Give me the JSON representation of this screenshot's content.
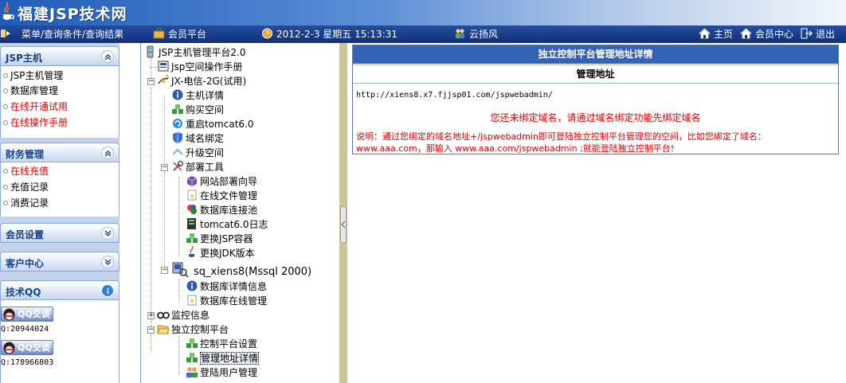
{
  "header": {
    "title": "福建JSP技术网"
  },
  "toolbar": {
    "menu": "菜单/查询条件/查询结果",
    "member_platform": "会员平台",
    "datetime": "2012-2-3 星期五 15:13:31",
    "user": "云扬风",
    "home": "主页",
    "member_center": "会员中心",
    "logout": "退出"
  },
  "sidebar": {
    "jsp_host": {
      "title": "JSP主机",
      "items": [
        "JSP主机管理",
        "数据库管理",
        "在线开通试用",
        "在线操作手册"
      ]
    },
    "finance": {
      "title": "财务管理",
      "items": [
        "在线充值",
        "充值记录",
        "消费记录"
      ]
    },
    "member_settings": {
      "title": "会员设置"
    },
    "customer_center": {
      "title": "客户中心"
    },
    "tech_qq": {
      "title": "技术QQ",
      "button_label": "QQ交谈",
      "contacts": [
        "Q:20944024",
        "Q:178966803"
      ]
    }
  },
  "tree": {
    "root": "JSP主机管理平台2.0",
    "manual": "Jsp空间操作手册",
    "host": "JX-电信-2G(试用)",
    "host_children": [
      "主机详情",
      "购买空间",
      "重启tomcat6.0",
      "域名绑定",
      "升级空间"
    ],
    "deploy": "部署工具",
    "deploy_children": [
      "网站部署向导",
      "在线文件管理",
      "数据库连接池",
      "tomcat6.0日志",
      "更换JSP容器",
      "更换JDK版本"
    ],
    "db": "sq_xiens8(Mssql 2000)",
    "db_children": [
      "数据库详情信息",
      "数据库在线管理"
    ],
    "monitor": "监控信息",
    "console": "独立控制平台",
    "console_children": [
      "控制平台设置",
      "管理地址详情",
      "登陆用户管理"
    ]
  },
  "detail": {
    "title": "独立控制平台管理地址详情",
    "subtitle": "管理地址",
    "url": "http://xiens8.x7.fjjsp01.com/jspwebadmin/",
    "warning": "您还未绑定域名，请通过域名绑定功能先绑定域名",
    "note_line1": "说明：通过您绑定的域名地址+/jspwebadmin即可登陆独立控制平台管理您的空间，比如您绑定了域名：",
    "note_line2": "www.aaa.com，那输入 www.aaa.com/jspwebadmin ;就能登陆独立控制平台!"
  },
  "colors": {
    "header_blue": "#1f5db8",
    "toolbar_blue": "#10307a",
    "panel_title": "#15428b",
    "alert_red": "#e00000"
  }
}
